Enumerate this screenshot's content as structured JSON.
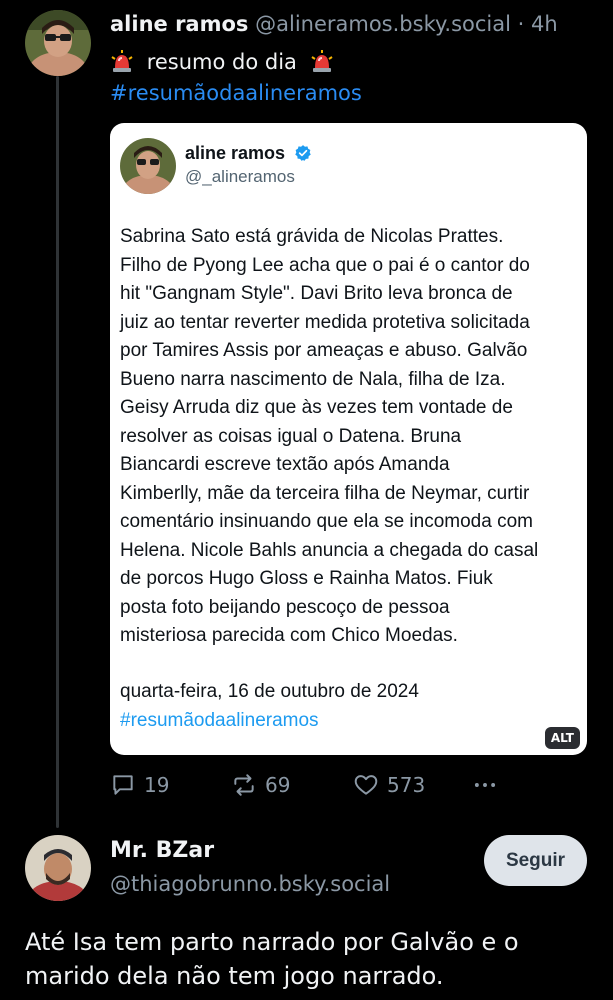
{
  "post1": {
    "author_name": "aline ramos",
    "author_handle": "@alineramos.bsky.social",
    "separator": "·",
    "time": "4h",
    "text": "resumo do dia",
    "hashtag": "#resumãodaalineramos",
    "embed": {
      "name": "aline ramos",
      "handle": "@_alineramos",
      "body": "Sabrina Sato está grávida de Nicolas Prattes.\nFilho de Pyong Lee acha que o pai é o cantor do\nhit \"Gangnam Style\". Davi Brito leva bronca de\njuiz ao tentar reverter medida protetiva solicitada\npor Tamires Assis por ameaças e abuso. Galvão\nBueno narra nascimento de Nala, filha de Iza.\nGeisy Arruda diz que às vezes tem vontade de\nresolver as coisas igual o Datena. Bruna\nBiancardi escreve textão após Amanda\nKimberlly, mãe da terceira filha de Neymar, curtir\ncomentário insinuando que ela se incomoda com\nHelena. Nicole Bahls anuncia a chegada do casal\nde porcos Hugo Gloss e Rainha Matos. Fiuk\nposta foto beijando pescoço de pessoa\nmisteriosa parecida com Chico Moedas.",
      "date": "quarta-feira, 16 de outubro de 2024",
      "hashtag": "#resumãodaalineramos",
      "alt_label": "ALT"
    },
    "actions": {
      "replies": "19",
      "reposts": "69",
      "likes": "573"
    }
  },
  "post2": {
    "author_name": "Mr. BZar",
    "author_handle": "@thiagobrunno.bsky.social",
    "follow_label": "Seguir",
    "text": "Até Isa tem parto narrado por Galvão e o marido dela não tem jogo narrado."
  },
  "colors": {
    "background": "#000000",
    "link": "#2a8cf3",
    "muted": "#8b98a5",
    "verified": "#1d9bf0"
  },
  "icons": [
    "siren-icon",
    "verified-badge-icon",
    "reply-icon",
    "repost-icon",
    "like-icon",
    "more-icon"
  ]
}
